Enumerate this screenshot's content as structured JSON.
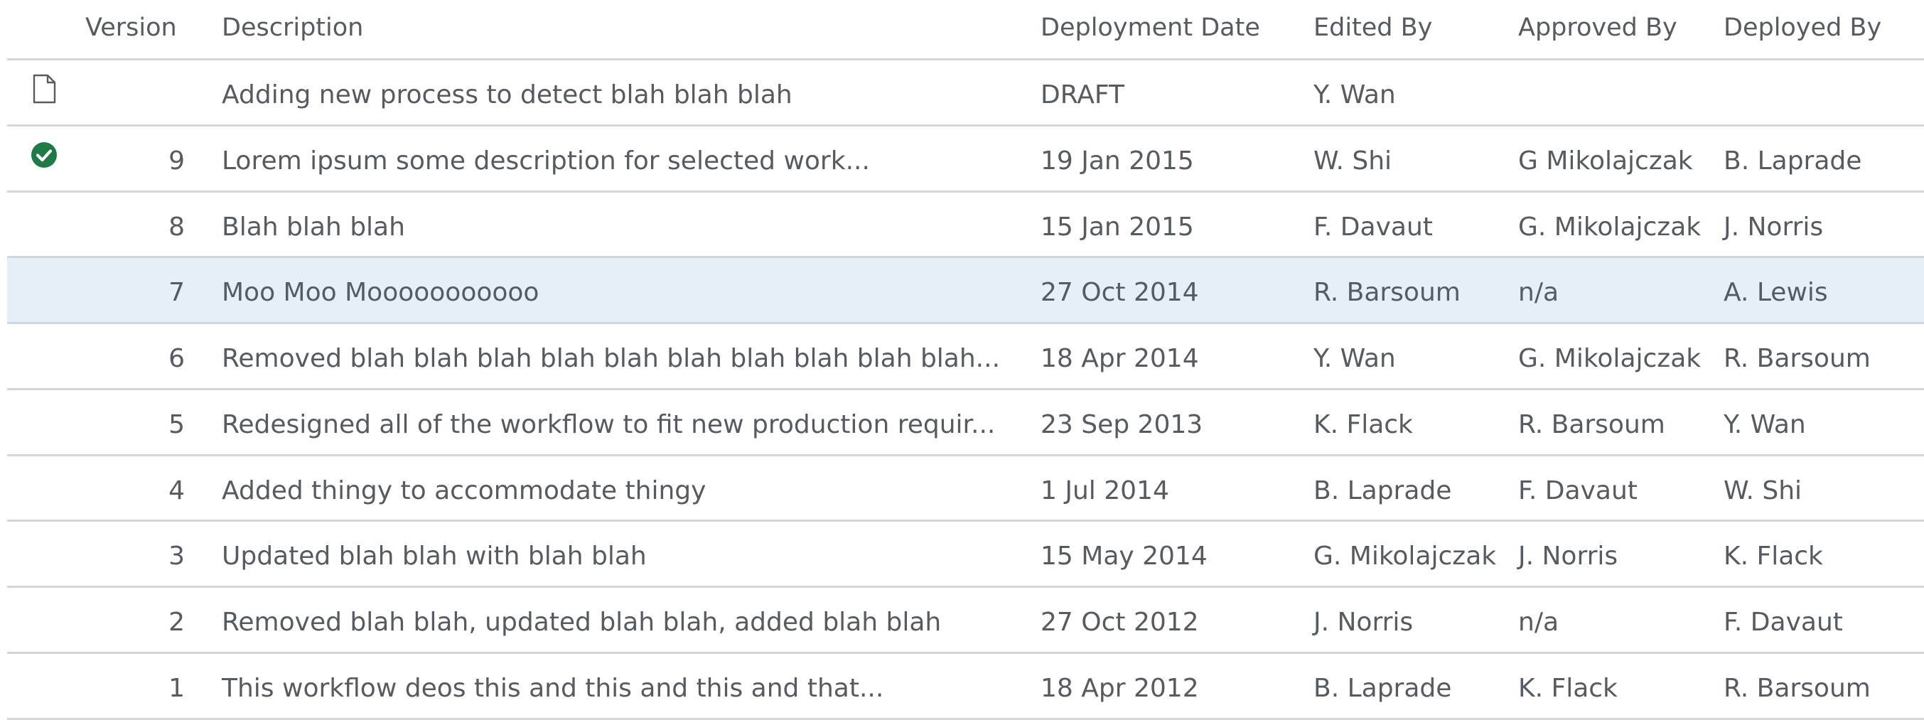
{
  "columns": {
    "version": "Version",
    "description": "Description",
    "deployment_date": "Deployment Date",
    "edited_by": "Edited By",
    "approved_by": "Approved By",
    "deployed_by": "Deployed By"
  },
  "colors": {
    "selected_row": "#e5eff8",
    "check_icon": "#1e7b45",
    "divider": "#d4d7da",
    "text": "#555b61"
  },
  "rows": [
    {
      "icon": "document-icon",
      "version": "",
      "description": "Adding new process to detect blah blah blah",
      "date": "DRAFT",
      "edited_by": "Y. Wan",
      "approved_by": "",
      "deployed_by": ""
    },
    {
      "icon": "check-circle-icon",
      "version": "9",
      "description": "Lorem ipsum some description for selected work...",
      "date": "19 Jan 2015",
      "edited_by": "W. Shi",
      "approved_by": "G Mikolajczak",
      "deployed_by": "B. Laprade"
    },
    {
      "icon": "",
      "version": "8",
      "description": "Blah blah blah",
      "date": "15 Jan 2015",
      "edited_by": "F. Davaut",
      "approved_by": "G. Mikolajczak",
      "deployed_by": "J. Norris"
    },
    {
      "icon": "",
      "version": "7",
      "description": "Moo Moo Mooooooooooo",
      "date": "27 Oct 2014",
      "edited_by": "R. Barsoum",
      "approved_by": "n/a",
      "deployed_by": "A. Lewis",
      "selected": true
    },
    {
      "icon": "",
      "version": "6",
      "description": "Removed blah blah blah blah blah blah blah blah blah blah...",
      "date": "18 Apr 2014",
      "edited_by": "Y. Wan",
      "approved_by": "G. Mikolajczak",
      "deployed_by": "R. Barsoum"
    },
    {
      "icon": "",
      "version": "5",
      "description": "Redesigned all of the workflow to fit new production requir...",
      "date": "23 Sep 2013",
      "edited_by": "K. Flack",
      "approved_by": "R. Barsoum",
      "deployed_by": "Y. Wan"
    },
    {
      "icon": "",
      "version": "4",
      "description": "Added thingy to accommodate thingy",
      "date": "1 Jul 2014",
      "edited_by": "B. Laprade",
      "approved_by": "F. Davaut",
      "deployed_by": "W. Shi"
    },
    {
      "icon": "",
      "version": "3",
      "description": "Updated blah blah with blah blah",
      "date": "15 May 2014",
      "edited_by": "G. Mikolajczak",
      "approved_by": "J. Norris",
      "deployed_by": "K. Flack"
    },
    {
      "icon": "",
      "version": "2",
      "description": "Removed blah blah, updated blah blah, added blah blah",
      "date": "27 Oct 2012",
      "edited_by": "J. Norris",
      "approved_by": "n/a",
      "deployed_by": "F. Davaut"
    },
    {
      "icon": "",
      "version": "1",
      "description": "This workflow deos this and this and this and that...",
      "date": "18 Apr 2012",
      "edited_by": "B. Laprade",
      "approved_by": "K. Flack",
      "deployed_by": "R. Barsoum"
    }
  ]
}
